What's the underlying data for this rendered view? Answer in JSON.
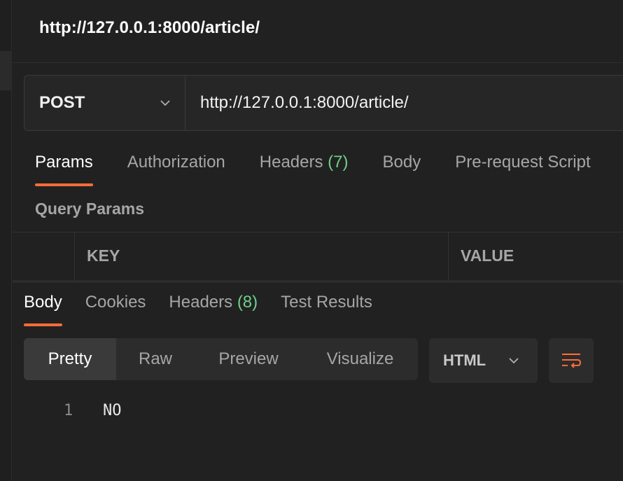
{
  "tab": {
    "title": "http://127.0.0.1:8000/article/"
  },
  "request": {
    "method": "POST",
    "url": "http://127.0.0.1:8000/article/"
  },
  "request_tabs": [
    {
      "label": "Params",
      "count": ""
    },
    {
      "label": "Authorization",
      "count": ""
    },
    {
      "label": "Headers",
      "count": "(7)"
    },
    {
      "label": "Body",
      "count": ""
    },
    {
      "label": "Pre-request Script",
      "count": ""
    }
  ],
  "query_params": {
    "title": "Query Params",
    "columns": [
      "KEY",
      "VALUE"
    ]
  },
  "response_tabs": [
    {
      "label": "Body",
      "count": ""
    },
    {
      "label": "Cookies",
      "count": ""
    },
    {
      "label": "Headers",
      "count": "(8)"
    },
    {
      "label": "Test Results",
      "count": ""
    }
  ],
  "view_modes": [
    "Pretty",
    "Raw",
    "Preview",
    "Visualize"
  ],
  "format": {
    "selected": "HTML"
  },
  "response_body": {
    "line_number": "1",
    "content": "NO"
  },
  "colors": {
    "accent": "#ff6c37",
    "count_green": "#6fcf8a",
    "background": "#212121"
  },
  "icons": {
    "method_dropdown": "chevron-down-icon",
    "format_dropdown": "chevron-down-icon",
    "wrap": "wrap-lines-icon"
  }
}
